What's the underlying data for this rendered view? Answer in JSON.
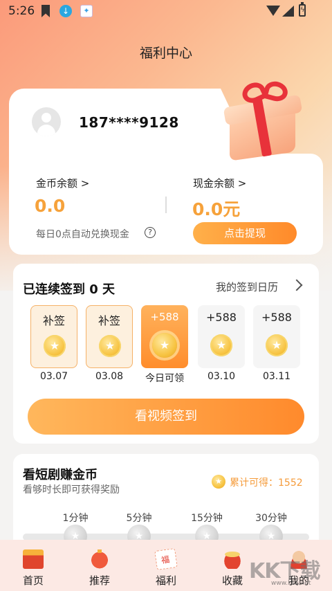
{
  "status_bar": {
    "time": "5:26"
  },
  "header": {
    "title": "福利中心"
  },
  "account": {
    "phone": "187****9128",
    "coin_label": "金币余额 >",
    "coin_value": "0.0",
    "cash_label": "现金余额 >",
    "cash_value": "0.0元",
    "exchange_note": "每日0点自动兑换现金",
    "withdraw_label": "点击提现"
  },
  "signin": {
    "streak_text": "已连续签到 0 天",
    "calendar_link": "我的签到日历",
    "days": [
      {
        "top": "补签",
        "date": "03.07",
        "state": "makeup"
      },
      {
        "top": "补签",
        "date": "03.08",
        "state": "makeup"
      },
      {
        "top": "+588",
        "date": "今日可领",
        "state": "today"
      },
      {
        "top": "+588",
        "date": "03.10",
        "state": "future"
      },
      {
        "top": "+588",
        "date": "03.11",
        "state": "future"
      }
    ],
    "video_button": "看视频签到"
  },
  "drama": {
    "title": "看短剧赚金币",
    "subtitle": "看够时长即可获得奖励",
    "total_label": "累计可得：1552",
    "milestones": [
      "1分钟",
      "5分钟",
      "15分钟",
      "30分钟"
    ]
  },
  "nav": {
    "items": [
      {
        "label": "首页",
        "icon": "home-icon"
      },
      {
        "label": "推荐",
        "icon": "lantern-icon"
      },
      {
        "label": "福利",
        "icon": "welfare-icon"
      },
      {
        "label": "收藏",
        "icon": "drum-icon"
      },
      {
        "label": "我的",
        "icon": "profile-icon"
      }
    ]
  },
  "watermark": {
    "text": "KK下载",
    "url": "www.kkx.net"
  },
  "colors": {
    "accent": "#ff8a2c",
    "gold": "#f6a23b",
    "nav_bg": "#fce9e4"
  }
}
